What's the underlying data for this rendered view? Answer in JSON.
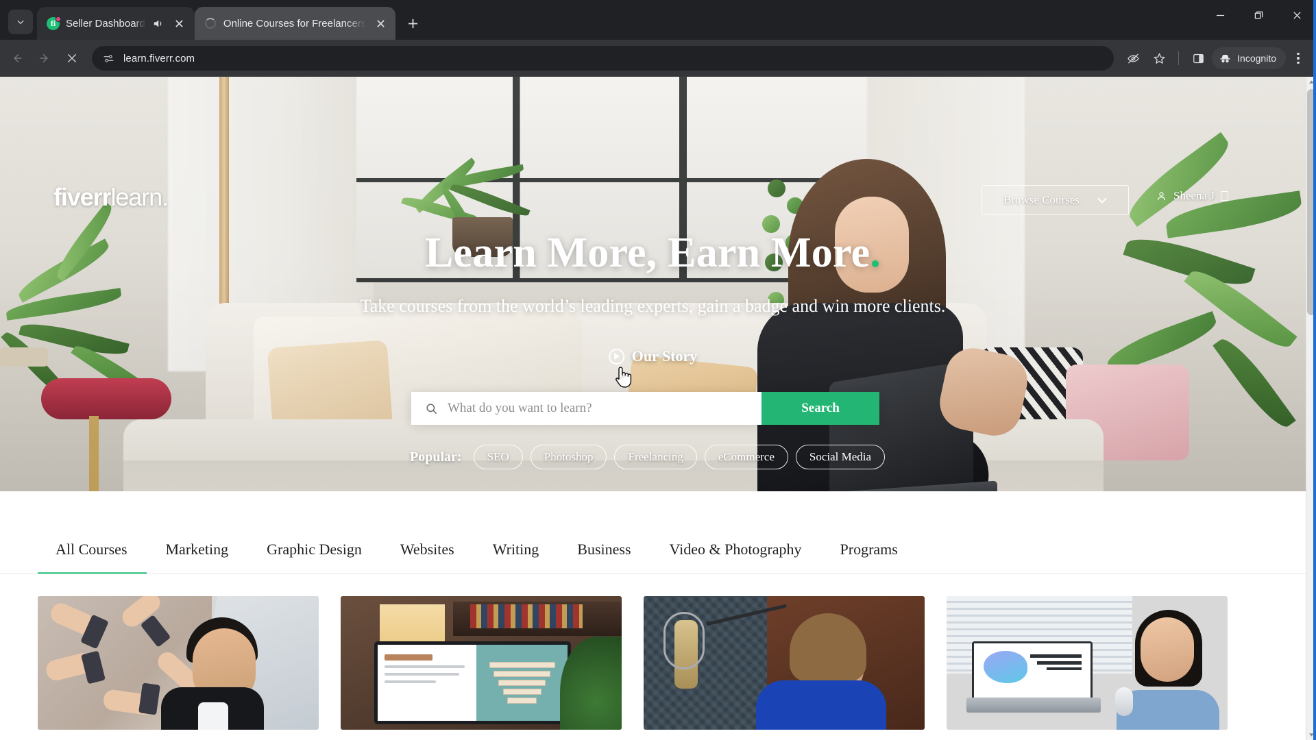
{
  "browser": {
    "tab_search_icon": "chevron-down-icon",
    "tabs": [
      {
        "title": "Seller Dashboard",
        "favicon": "fiverr-icon",
        "active": false,
        "audio": true,
        "notification_dot": true
      },
      {
        "title": "Online Courses for Freelancers",
        "favicon": "loading-spinner-icon",
        "active": true,
        "audio": false,
        "notification_dot": false
      }
    ],
    "new_tab_label": "+",
    "window_controls": {
      "minimize": "minimize-icon",
      "maximize": "restore-icon",
      "close": "close-icon"
    },
    "toolbar": {
      "back": "back-arrow-icon",
      "forward": "forward-arrow-icon",
      "stop": "stop-loading-icon",
      "site_info": "site-settings-icon",
      "url": "learn.fiverr.com",
      "tracking_protection": "eye-slash-icon",
      "bookmark": "star-icon",
      "side_panel": "side-panel-icon",
      "profile_label": "Incognito",
      "profile_icon": "incognito-icon",
      "menu": "three-dot-menu-icon"
    }
  },
  "page": {
    "hero": {
      "logo_bold": "fiverr",
      "logo_light": "learn.",
      "browse_label": "Browse Courses",
      "browse_chevron": "chevron-down-icon",
      "user_icon": "person-icon",
      "user_name": "Sheena J",
      "title": "Learn More, Earn More",
      "title_dot": ".",
      "subtitle": "Take courses from the world’s leading experts, gain a badge and win more clients.",
      "our_story_label": "Our Story",
      "our_story_icon": "play-circle-icon",
      "cursor_icon": "pointer-hand-cursor",
      "search_icon": "search-icon",
      "search_placeholder": "What do you want to learn?",
      "search_value": "",
      "search_button": "Search",
      "popular_label": "Popular:",
      "popular_tags": [
        "SEO",
        "Photoshop",
        "Freelancing",
        "eCommerce",
        "Social Media"
      ]
    },
    "category_tabs": [
      {
        "label": "All Courses",
        "active": true
      },
      {
        "label": "Marketing",
        "active": false
      },
      {
        "label": "Graphic Design",
        "active": false
      },
      {
        "label": "Websites",
        "active": false
      },
      {
        "label": "Writing",
        "active": false
      },
      {
        "label": "Business",
        "active": false
      },
      {
        "label": "Video & Photography",
        "active": false
      },
      {
        "label": "Programs",
        "active": false
      }
    ],
    "course_cards": [
      {
        "thumb": "mobile-marketing-thumbnail"
      },
      {
        "thumb": "marketing-funnel-slide-thumbnail"
      },
      {
        "thumb": "podcast-microphone-thumbnail"
      },
      {
        "thumb": "desk-laptop-presenter-thumbnail"
      }
    ]
  },
  "colors": {
    "accent_green": "#1dbf73",
    "search_button_green": "#22b573",
    "tab_underline_green": "#5fcf9d",
    "chrome_dark": "#202124",
    "toolbar_dark": "#35363a",
    "window_border_blue": "#1b6fd4"
  },
  "scrollbar": {
    "up_arrow": "scroll-up-icon",
    "down_arrow": "scroll-down-icon"
  }
}
